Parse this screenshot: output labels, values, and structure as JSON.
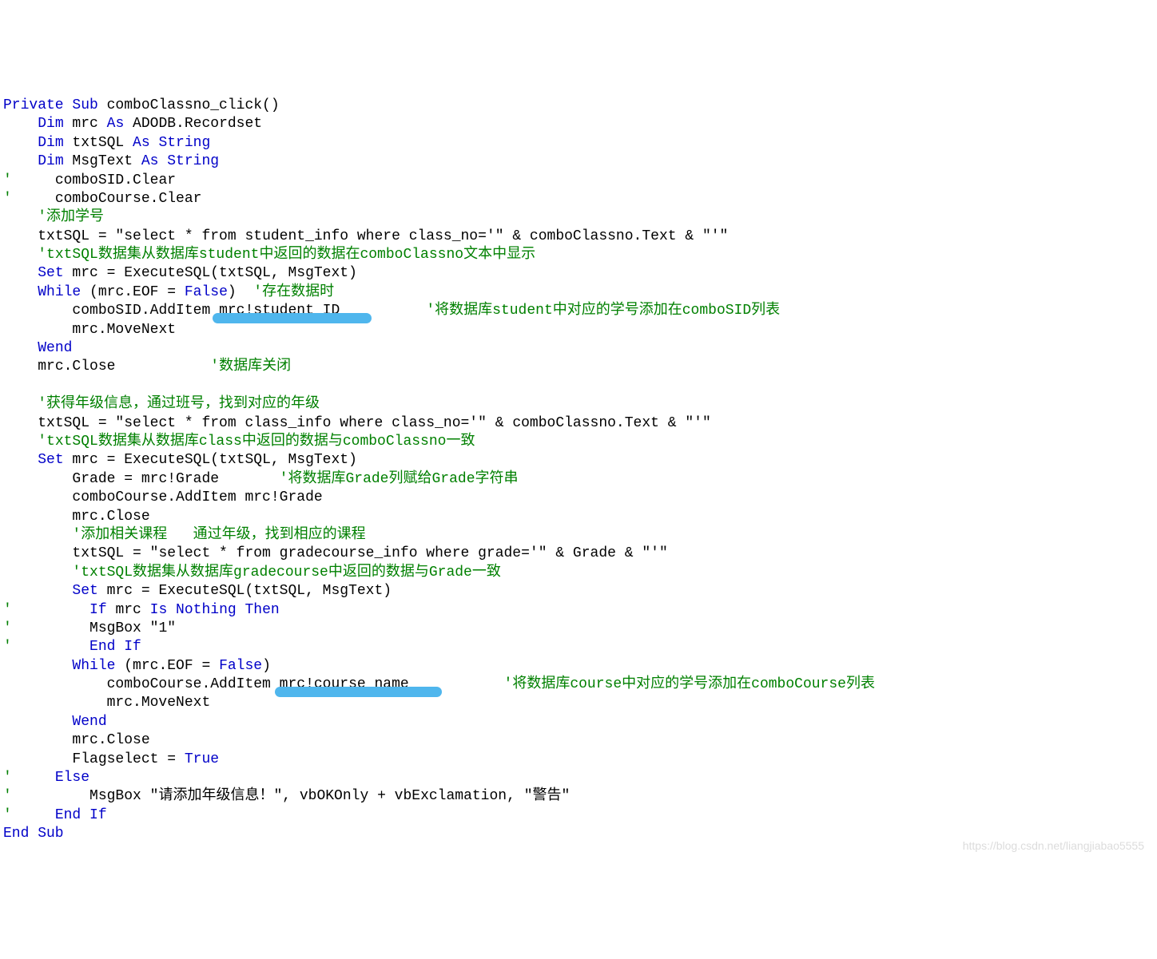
{
  "code": {
    "l1_k1": "Private Sub",
    "l1_t1": " comboClassno_click()",
    "l2_k1": "Dim",
    "l2_t1": " mrc ",
    "l2_k2": "As",
    "l2_t2": " ADODB.Recordset",
    "l3_k1": "Dim",
    "l3_t1": " txtSQL ",
    "l3_k2": "As String",
    "l4_k1": "Dim",
    "l4_t1": " MsgText ",
    "l4_k2": "As String",
    "l5_cm": "'",
    "l5_t1": "     comboSID.Clear",
    "l6_cm": "'",
    "l6_t1": "     comboCourse.Clear",
    "l7_cm": "'添加学号",
    "l8_t1": "txtSQL = \"select * from student_info where class_no='\" & comboClassno.Text & \"'\"",
    "l9_cm": "'txtSQL数据集从数据库student中返回的数据在comboClassno文本中显示",
    "l10_k1": "Set",
    "l10_t1": " mrc = ExecuteSQL(txtSQL, MsgText)",
    "l11_k1": "While",
    "l11_t1": " (mrc.EOF = ",
    "l11_k2": "False",
    "l11_t2": ")  ",
    "l11_cm": "'存在数据时",
    "l12_t1": "comboSID.AddItem ",
    "l12_t2": "mrc!student_ID",
    "l12_cm": "'将数据库student中对应的学号添加在comboSID列表",
    "l13_t1": "mrc.MoveNext",
    "l14_k1": "Wend",
    "l15_t1": "mrc.Close           ",
    "l15_cm": "'数据库关闭",
    "l17_cm": "'获得年级信息，通过班号，找到对应的年级",
    "l18_t1": "txtSQL = \"select * from class_info where class_no='\" & comboClassno.Text & \"'\"",
    "l19_cm": "'txtSQL数据集从数据库class中返回的数据与comboClassno一致",
    "l20_k1": "Set",
    "l20_t1": " mrc = ExecuteSQL(txtSQL, MsgText)",
    "l21_t1": "Grade = mrc!Grade       ",
    "l21_cm": "'将数据库Grade列赋给Grade字符串",
    "l22_t1": "comboCourse.AddItem mrc!Grade",
    "l23_t1": "mrc.Close",
    "l24_cm": "'添加相关课程   通过年级，找到相应的课程",
    "l25_t1": "txtSQL = \"select * from gradecourse_info where grade='\" & Grade & \"'\"",
    "l26_cm": "'txtSQL数据集从数据库gradecourse中返回的数据与Grade一致",
    "l27_k1": "Set",
    "l27_t1": " mrc = ExecuteSQL(txtSQL, MsgText)",
    "l28_cm": "'",
    "l28_k1": "If",
    "l28_t1": " mrc ",
    "l28_k2": "Is Nothing Then",
    "l29_cm": "'",
    "l29_t1": "MsgBox \"1\"",
    "l30_cm": "'",
    "l30_k1": "End If",
    "l31_k1": "While",
    "l31_t1": " (mrc.EOF = ",
    "l31_k2": "False",
    "l31_t2": ")",
    "l32_t1": "comboCourse.AddItem ",
    "l32_t2": "mrc!course_name",
    "l32_cm": "'将数据库course中对应的学号添加在comboCourse列表",
    "l33_t1": "mrc.MoveNext",
    "l34_k1": "Wend",
    "l35_t1": "mrc.Close",
    "l36_t1": "Flagselect = ",
    "l36_k1": "True",
    "l37_cm": "'",
    "l37_k1": "Else",
    "l38_cm": "'",
    "l38_t1": "MsgBox \"请添加年级信息！\", vbOKOnly + vbExclamation, \"警告\"",
    "l39_cm": "'",
    "l39_k1": "End If",
    "l40_k1": "End Sub"
  },
  "watermark": "https://blog.csdn.net/liangjiabao5555"
}
